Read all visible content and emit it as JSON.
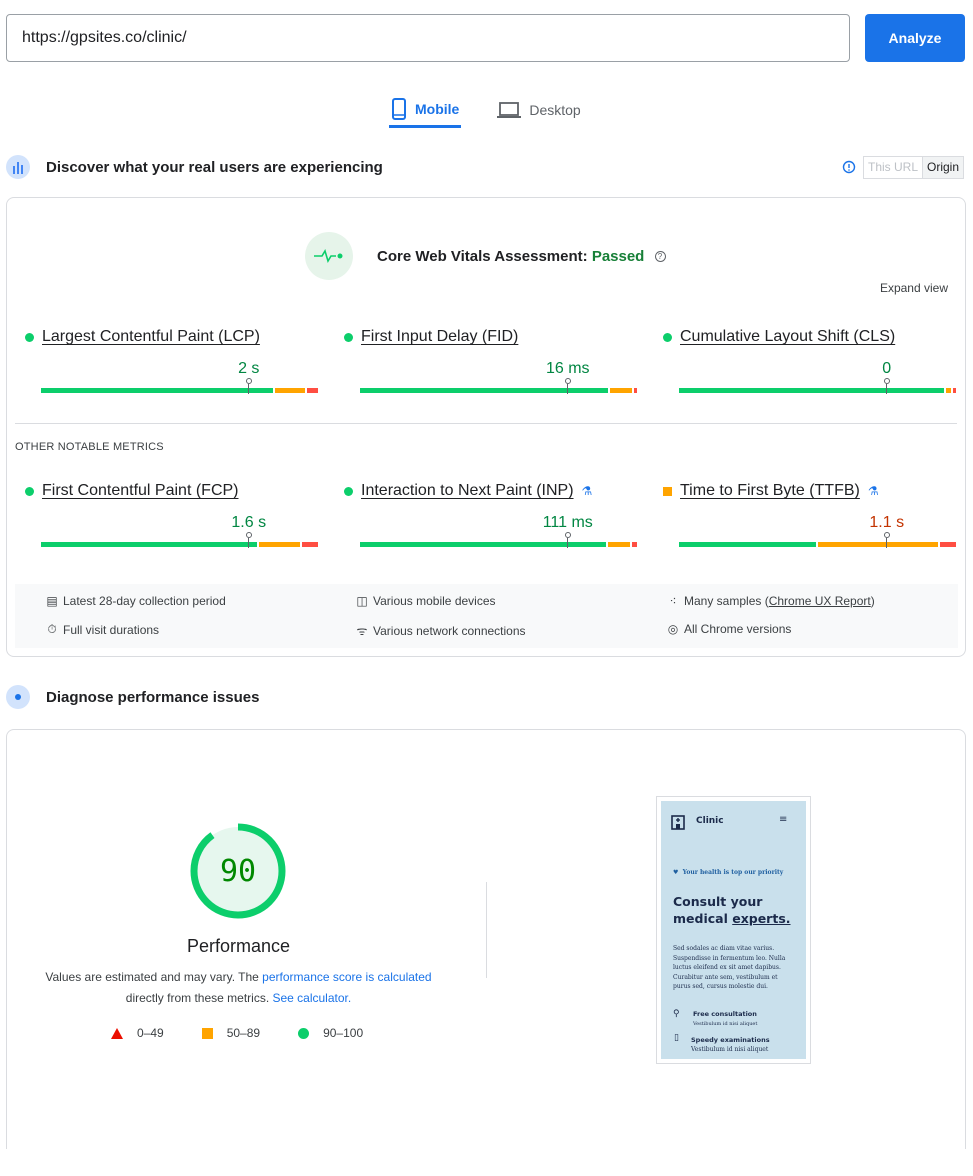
{
  "url_input": {
    "value": "https://gpsites.co/clinic/"
  },
  "analyze_label": "Analyze",
  "tabs": [
    {
      "label": "Mobile",
      "icon": "smartphone-icon",
      "active": true
    },
    {
      "label": "Desktop",
      "icon": "laptop-icon",
      "active": false
    }
  ],
  "field": {
    "title": "Discover what your real users are experiencing",
    "toggle": {
      "this_url": "This URL",
      "origin": "Origin",
      "selected": "Origin"
    },
    "assessment_label": "Core Web Vitals Assessment:",
    "assessment_status": "Passed",
    "expand_view": "Expand view",
    "other_label": "OTHER NOTABLE METRICS",
    "core_metrics": [
      {
        "name": "Largest Contentful Paint (LCP)",
        "value": "2 s",
        "status": "good",
        "distribution": [
          84,
          11,
          4
        ],
        "marker_percentile": 75
      },
      {
        "name": "First Input Delay (FID)",
        "value": "16 ms",
        "status": "good",
        "distribution": [
          91,
          8,
          1
        ],
        "marker_percentile": 75
      },
      {
        "name": "Cumulative Layout Shift (CLS)",
        "value": "0",
        "status": "good",
        "distribution": [
          96,
          2,
          1
        ],
        "marker_percentile": 75
      }
    ],
    "other_metrics": [
      {
        "name": "First Contentful Paint (FCP)",
        "value": "1.6 s",
        "status": "good",
        "experimental": false,
        "distribution": [
          79,
          15,
          6
        ],
        "marker_percentile": 75
      },
      {
        "name": "Interaction to Next Paint (INP)",
        "value": "111 ms",
        "status": "good",
        "experimental": true,
        "distribution": [
          90,
          8,
          2
        ],
        "marker_percentile": 75
      },
      {
        "name": "Time to First Byte (TTFB)",
        "value": "1.1 s",
        "status": "average",
        "experimental": true,
        "distribution": [
          50,
          44,
          6
        ],
        "marker_percentile": 75
      }
    ],
    "info": [
      {
        "icon": "calendar-icon",
        "text": "Latest 28-day collection period"
      },
      {
        "icon": "devices-icon",
        "text": "Various mobile devices"
      },
      {
        "icon": "samples-icon",
        "text": "Many samples (",
        "link": "Chrome UX Report",
        "after": ")"
      },
      {
        "icon": "timer-icon",
        "text": "Full visit durations"
      },
      {
        "icon": "network-icon",
        "text": "Various network connections"
      },
      {
        "icon": "chrome-icon",
        "text": "All Chrome versions"
      }
    ]
  },
  "lab": {
    "title": "Diagnose performance issues",
    "score": "90",
    "score_value": 90,
    "score_label": "Performance",
    "note_1": "Values are estimated and may vary. The ",
    "note_link_1": "performance score is calculated",
    "note_2": "directly from these metrics. ",
    "note_link_2": "See calculator.",
    "legend": [
      {
        "label": "0–49",
        "shape": "triangle",
        "color": "#ff4e42"
      },
      {
        "label": "50–89",
        "shape": "square",
        "color": "#ffa400"
      },
      {
        "label": "90–100",
        "shape": "circle",
        "color": "#0cce6b"
      }
    ],
    "screenshot": {
      "brand": "Clinic",
      "tagline": "Your health is top our priority",
      "headline_1": "Consult your",
      "headline_2": "medical ",
      "headline_3": "experts.",
      "body": "Sed sodales ac diam vitae varius. Suspendisse in fermentum leo. Nulla luctus eleifend ex sit amet dapibus. Curabitur ante sem, vestibulum et purus sed, cursus molestie dui.",
      "feature_1": "Free consultation",
      "feature_1_sub": "Vestibulum id nisi aliquet",
      "feature_2": "Speedy examinations",
      "feature_2_sub": "Vestibulum id nisi aliquet"
    }
  },
  "colors": {
    "good": "#0cce6b",
    "average": "#ffa400",
    "poor": "#ff4e42",
    "accent": "#1a73e8",
    "good_text": "#018642",
    "average_text": "#c33300"
  }
}
